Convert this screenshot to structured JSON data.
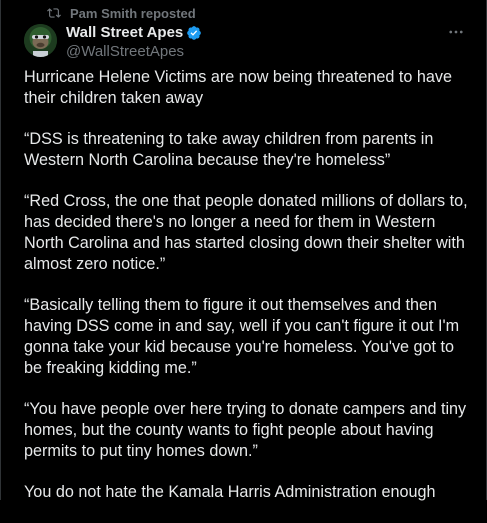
{
  "repost": {
    "icon": "repost-icon",
    "text": "Pam Smith reposted"
  },
  "author": {
    "display_name": "Wall Street Apes",
    "handle": "@WallStreetApes",
    "verified_icon": "verified-badge-icon",
    "avatar_icon": "ape-avatar"
  },
  "more_icon": "more-dots-icon",
  "tweet": {
    "paragraphs": [
      "Hurricane Helene Victims are now being threatened to have their children taken away",
      "“DSS is threatening to take away children from parents in Western North Carolina because they're homeless”",
      "“Red Cross, the one that people donated millions of dollars to, has decided there's no longer a need for them in Western North Carolina and has started closing down their shelter with almost zero notice.”",
      "“Basically telling them to figure it out themselves and then having DSS come in and say, well if you can't figure it out I'm gonna take your kid because you're homeless. You've got to be freaking kidding me.”",
      "“You have people over here trying to donate campers and tiny homes, but the county wants to fight people about having permits to put tiny homes down.”",
      "You do not hate the Kamala Harris Administration enough"
    ]
  },
  "colors": {
    "background": "#000000",
    "text": "#e7e9ea",
    "secondary": "#71767b",
    "verified": "#1d9bf0"
  }
}
